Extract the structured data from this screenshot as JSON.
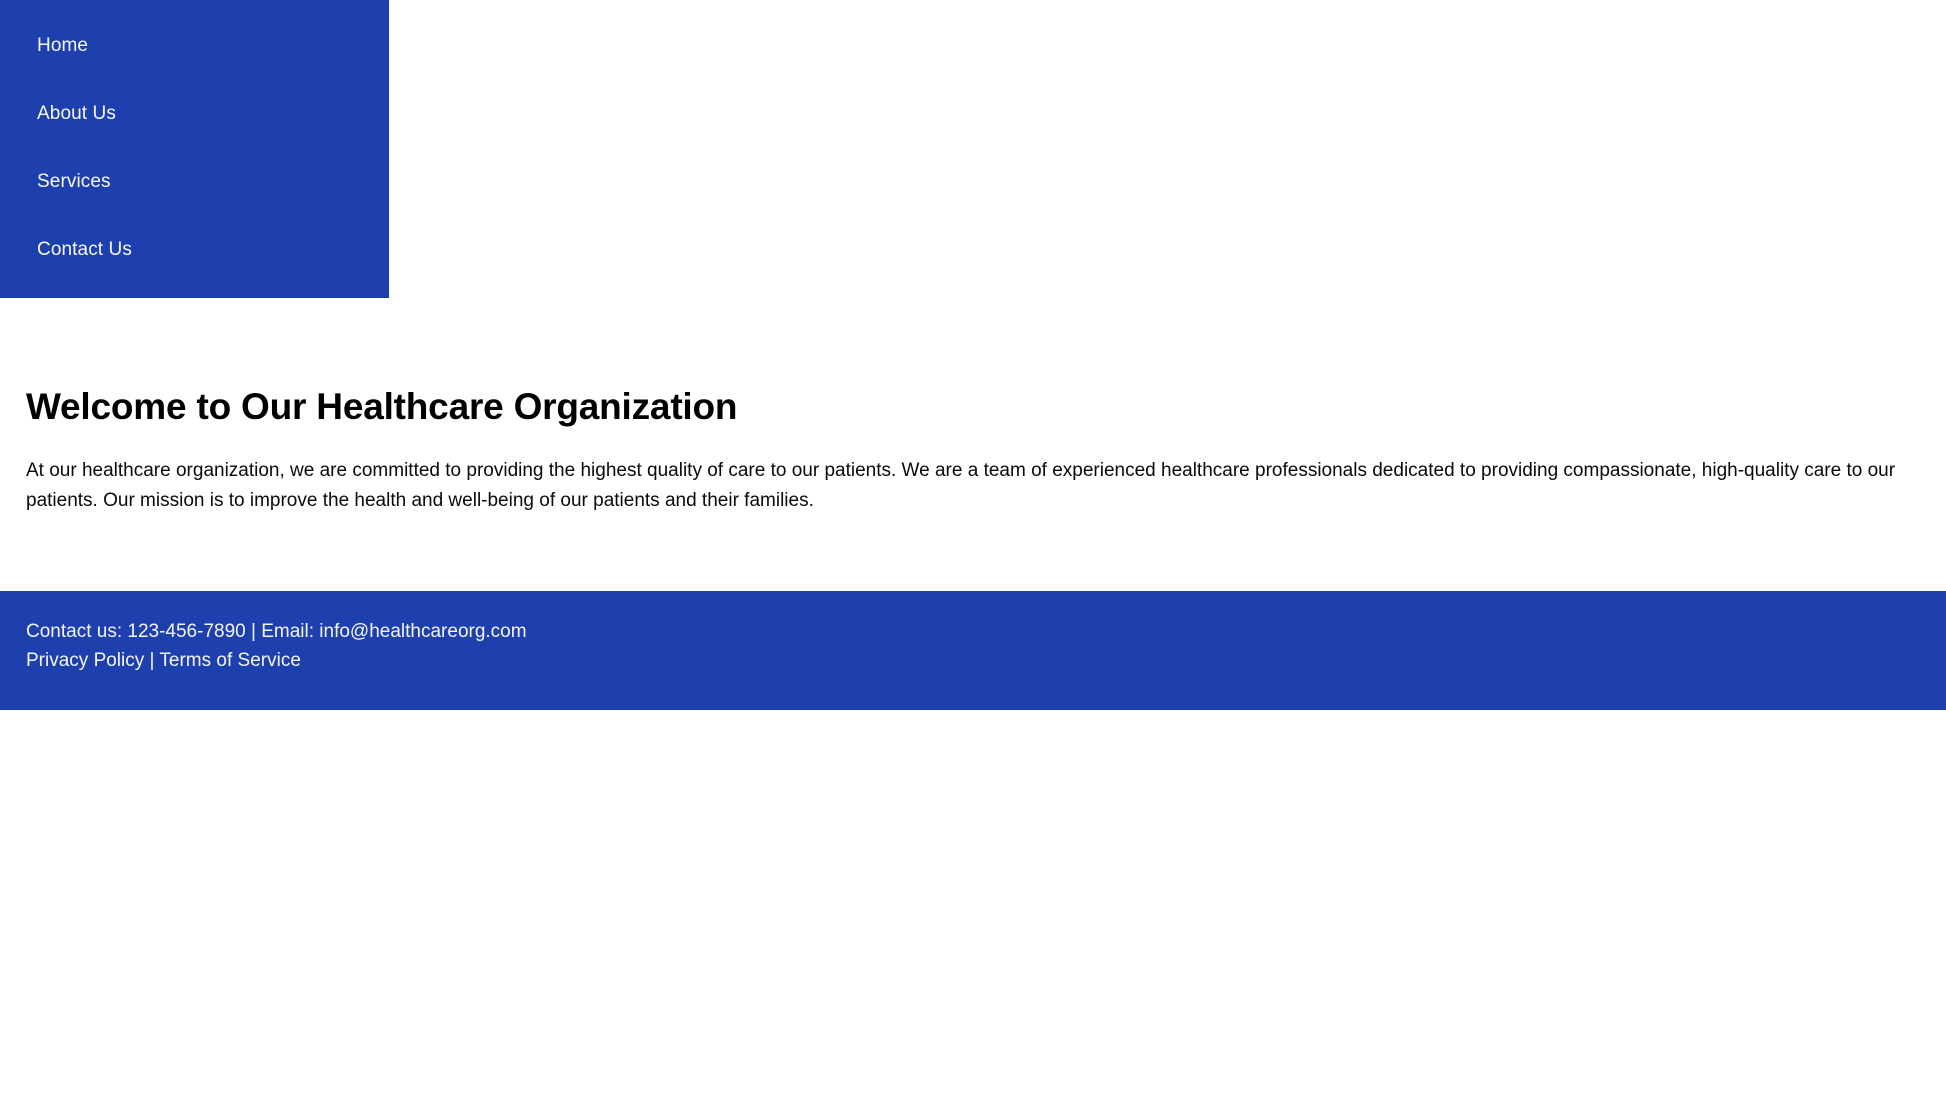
{
  "theme": {
    "brand_blue": "#1e40af",
    "text_dark": "#0a0a0a",
    "text_on_brand": "#f5f5f6",
    "page_background": "#ffffff"
  },
  "sidebar": {
    "items": [
      {
        "label": "Home"
      },
      {
        "label": "About Us"
      },
      {
        "label": "Services"
      },
      {
        "label": "Contact Us"
      }
    ]
  },
  "main": {
    "title": "Welcome to Our Healthcare Organization",
    "paragraph": "At our healthcare organization, we are committed to providing the highest quality of care to our patients. We are a team of experienced healthcare professionals dedicated to providing compassionate, high-quality care to our patients. Our mission is to improve the health and well-being of our patients and their families."
  },
  "footer": {
    "contact_prefix": "Contact us: ",
    "phone": "123-456-7890",
    "divider": " | ",
    "email_prefix": "Email: ",
    "email": "info@healthcareorg.com",
    "privacy_policy": "Privacy Policy",
    "links_divider": " | ",
    "terms_of_service": "Terms of Service"
  }
}
